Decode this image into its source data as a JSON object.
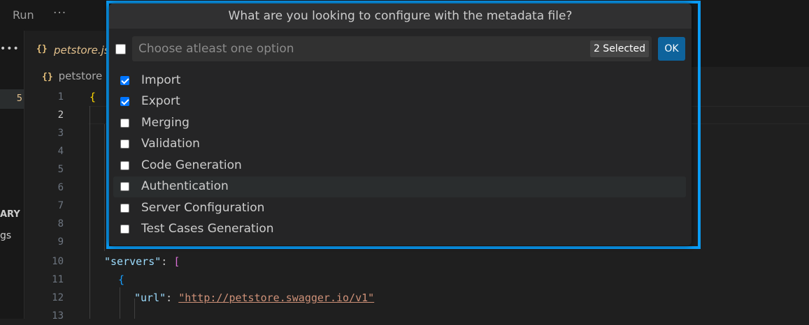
{
  "menu": {
    "run": "Run",
    "more": "···"
  },
  "side": {
    "dots": "•••",
    "badge": "5",
    "section_fragment": "ARY",
    "item_fragment": "gs"
  },
  "tab": {
    "icon": "{}",
    "label": "petstore.js"
  },
  "breadcrumb": {
    "icon": "{}",
    "label": "petstore"
  },
  "editor": {
    "line_numbers": [
      "1",
      "2",
      "3",
      "4",
      "5",
      "6",
      "7",
      "8",
      "9",
      "10",
      "11",
      "12",
      "13"
    ],
    "active_line": "2",
    "line1": "{",
    "line10_key": "\"servers\"",
    "line10_colon": ": ",
    "line10_bracket": "[",
    "line11": "{",
    "line12_key": "\"url\"",
    "line12_colon": ": ",
    "line12_value": "\"http://petstore.swagger.io/v1\""
  },
  "quickpick": {
    "title": "What are you looking to configure with the metadata file?",
    "placeholder": "Choose atleast one option",
    "selected_count": "2 Selected",
    "ok_label": "OK",
    "options": [
      {
        "label": "Import",
        "checked": true
      },
      {
        "label": "Export",
        "checked": true
      },
      {
        "label": "Merging",
        "checked": false
      },
      {
        "label": "Validation",
        "checked": false
      },
      {
        "label": "Code Generation",
        "checked": false
      },
      {
        "label": "Authentication",
        "checked": false
      },
      {
        "label": "Server Configuration",
        "checked": false
      },
      {
        "label": "Test Cases Generation",
        "checked": false
      }
    ]
  },
  "colors": {
    "accent": "#0a9cf5",
    "ok_button": "#0e639c",
    "checkbox_checked": "#0075ff"
  }
}
